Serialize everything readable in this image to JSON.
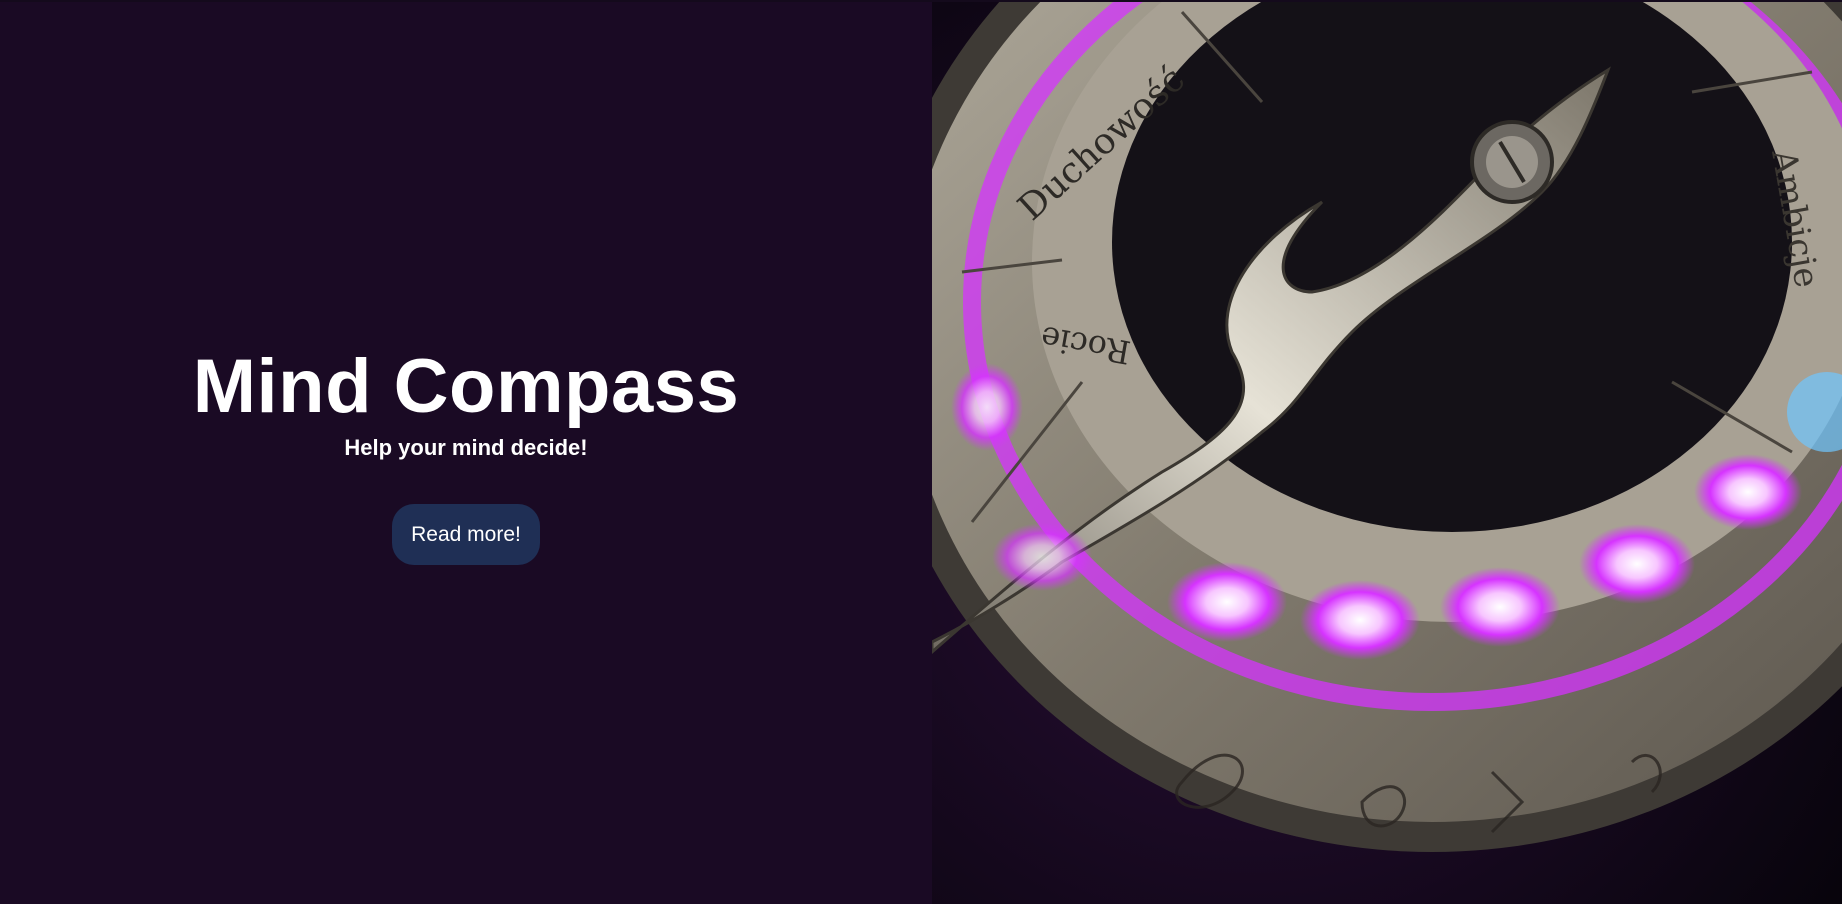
{
  "hero": {
    "title": "Mind Compass",
    "subtitle": "Help your mind decide!",
    "cta_label": "Read more!"
  },
  "photo": {
    "engraved_words": [
      "Duchowość",
      "Ambicje",
      "Rocie"
    ],
    "subject": "compass-photo"
  },
  "colors": {
    "background": "#1a0a24",
    "button": "#1f2f55",
    "text": "#ffffff",
    "led_glow": "#d633ff"
  }
}
